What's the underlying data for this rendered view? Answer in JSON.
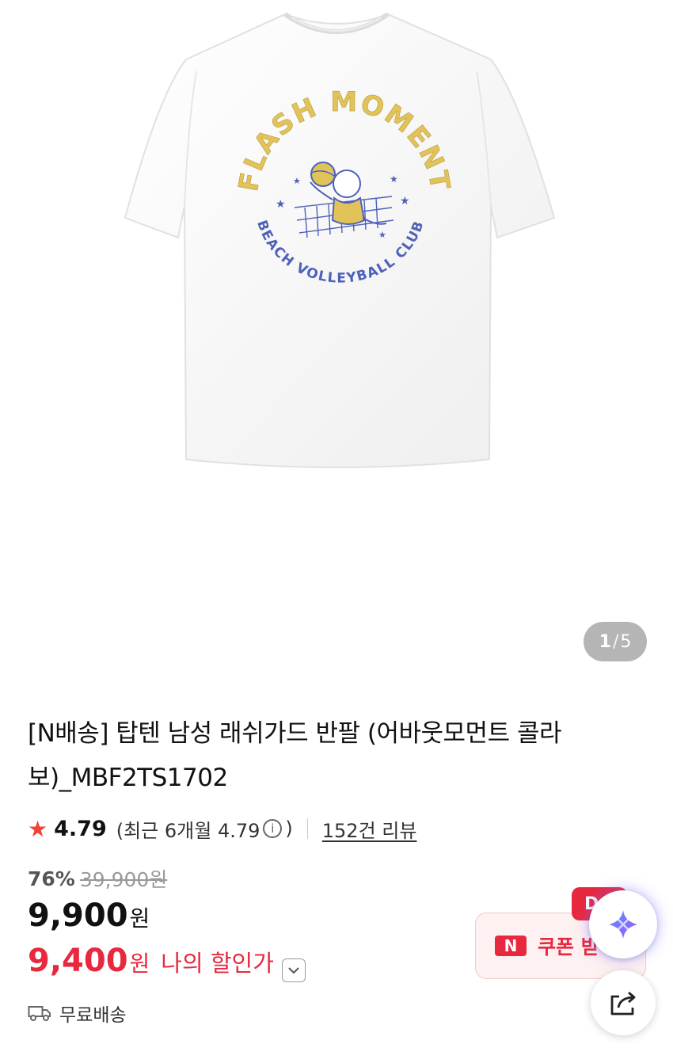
{
  "product": {
    "image_alt": "white t-shirt",
    "graphic_line1": "FLASH MOMENT",
    "graphic_line2": "BEACH VOLLEYBALL CLUB",
    "image_counter": {
      "current": "1",
      "separator": "/",
      "total": "5"
    },
    "title": "[N배송] 탑텐 남성 래쉬가드 반팔 (어바웃모먼트 콜라보)_MBF2TS1702"
  },
  "rating": {
    "star_icon": "star-icon",
    "score": "4.79",
    "recent_prefix": "(최근 6개월 4.79",
    "recent_suffix": ")",
    "info_icon_glyph": "i",
    "reviews": "152건 리뷰"
  },
  "pricing": {
    "discount_percent": "76%",
    "original_price": "39,900원",
    "price": "9,900",
    "price_unit": "원",
    "my_price": "9,400",
    "my_price_unit": "원",
    "my_price_label": "나의 할인가"
  },
  "shipping": {
    "label": "무료배송"
  },
  "coupon": {
    "logo": "N",
    "label": "쿠폰 받",
    "badge": "D"
  },
  "colors": {
    "accent_red": "#e8283e",
    "star_red": "#f04438",
    "graphic_yellow": "#e2c35a",
    "graphic_blue": "#4e61b8"
  }
}
